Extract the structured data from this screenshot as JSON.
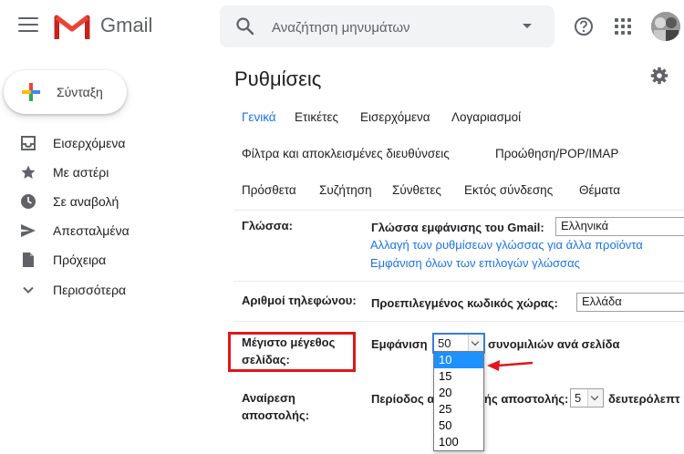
{
  "app": {
    "name": "Gmail",
    "search": {
      "placeholder": "Αναζήτηση μηνυμάτων"
    }
  },
  "sidebar": {
    "compose_label": "Σύνταξη",
    "items": [
      {
        "label": "Εισερχόμενα",
        "icon": "inbox-icon"
      },
      {
        "label": "Με αστέρι",
        "icon": "star-icon"
      },
      {
        "label": "Σε αναβολή",
        "icon": "clock-icon"
      },
      {
        "label": "Απεσταλμένα",
        "icon": "send-icon"
      },
      {
        "label": "Πρόχειρα",
        "icon": "draft-icon"
      },
      {
        "label": "Περισσότερα",
        "icon": "chevron-down-icon"
      }
    ]
  },
  "settings": {
    "title": "Ρυθμίσεις",
    "tabs_row1": [
      "Γενικά",
      "Ετικέτες",
      "Εισερχόμενα",
      "Λογαριασμοί"
    ],
    "tabs_row2": [
      "Φίλτρα και αποκλεισμένες διευθύνσεις",
      "Προώθηση/POP/IMAP"
    ],
    "tabs_row3": [
      "Πρόσθετα",
      "Συζήτηση",
      "Σύνθετες",
      "Εκτός σύνδεσης",
      "Θέματα"
    ],
    "active_tab": "Γενικά",
    "language": {
      "label": "Γλώσσα:",
      "display_label": "Γλώσσα εμφάνισης του Gmail:",
      "value": "Ελληνικά",
      "link1": "Αλλαγή των ρυθμίσεων γλώσσας για άλλα προϊόντα",
      "link2": "Εμφάνιση όλων των επιλογών γλώσσας"
    },
    "phone": {
      "label": "Αριθμοί τηλεφώνου:",
      "country_label": "Προεπιλεγμένος κωδικός χώρας:",
      "value": "Ελλάδα"
    },
    "page_size": {
      "label_line1": "Μέγιστο μέγεθος",
      "label_line2": "σελίδας:",
      "show_label": "Εμφάνιση",
      "value": "50",
      "suffix": "συνομιλιών ανά σελίδα",
      "options": [
        "10",
        "15",
        "20",
        "25",
        "50",
        "100"
      ],
      "highlighted_option": "10"
    },
    "undo_send": {
      "label_line1": "Αναίρεση",
      "label_line2": "αποστολής:",
      "period_prefix": "Περίοδος α",
      "period_mid": "ής αποστολής:",
      "value": "5",
      "suffix": "δευτερόλεπτ"
    }
  },
  "colors": {
    "accent": "#1a73e8",
    "annotation_red": "#e0161b",
    "dropdown_selected": "#1e90ff"
  }
}
